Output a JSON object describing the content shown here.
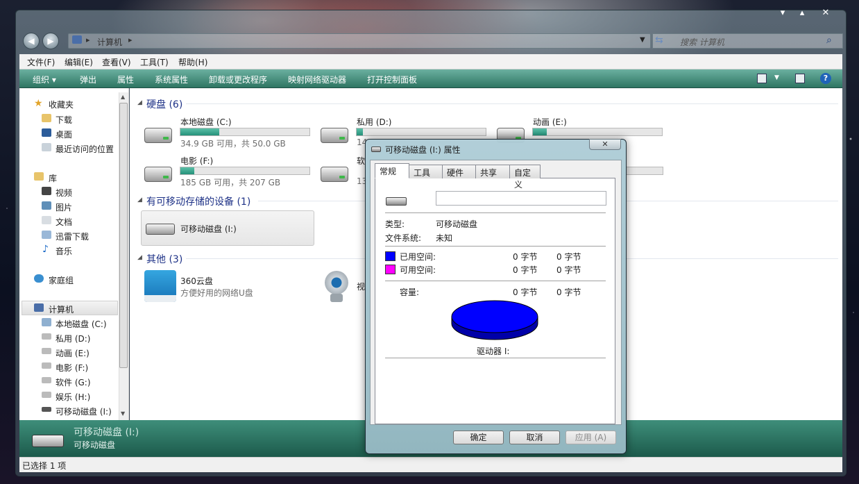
{
  "window": {
    "min": "▾",
    "max": "▴",
    "close": "✕"
  },
  "address": {
    "crumb": "计算机",
    "arrow1": "▸",
    "arrow2": "▸",
    "search_placeholder": "搜索 计算机"
  },
  "menu": [
    "文件(F)",
    "编辑(E)",
    "查看(V)",
    "工具(T)",
    "帮助(H)"
  ],
  "toolbar": [
    "组织 ▾",
    "弹出",
    "属性",
    "系统属性",
    "卸载或更改程序",
    "映射网络驱动器",
    "打开控制面板"
  ],
  "nav": {
    "favorites": "收藏夹",
    "fav_items": [
      "下载",
      "桌面",
      "最近访问的位置"
    ],
    "libraries": "库",
    "lib_items": [
      "视频",
      "图片",
      "文档",
      "迅雷下载",
      "音乐"
    ],
    "homegroup": "家庭组",
    "computer": "计算机",
    "drives": [
      "本地磁盘 (C:)",
      "私用 (D:)",
      "动画 (E:)",
      "电影 (F:)",
      "软件 (G:)",
      "娱乐 (H:)",
      "可移动磁盘 (I:)"
    ]
  },
  "groups": {
    "hdd": "硬盘 (6)",
    "removable": "有可移动存储的设备 (1)",
    "other": "其他 (3)"
  },
  "drives": [
    {
      "name": "本地磁盘 (C:)",
      "free": "34.9 GB 可用，共 50.0 GB",
      "used_fraction": 0.3
    },
    {
      "name": "私用 (D:)",
      "free": "14",
      "used_fraction": 0.05
    },
    {
      "name": "动画 (E:)",
      "free": "",
      "used_fraction": 0.11
    },
    {
      "name": "电影 (F:)",
      "free": "185 GB 可用，共 207 GB",
      "used_fraction": 0.11
    },
    {
      "name": "软",
      "free": "13",
      "used_fraction": 0.06
    }
  ],
  "removable": {
    "name": "可移动磁盘 (I:)"
  },
  "other": [
    {
      "name": "360云盘",
      "desc": "方便好用的网络U盘"
    },
    {
      "name": "视"
    }
  ],
  "details": {
    "title": "可移动磁盘 (I:)",
    "sub": "可移动磁盘"
  },
  "status": "已选择 1 项",
  "dialog": {
    "title": "可移动磁盘 (I:) 属性",
    "close": "✕",
    "tabs": [
      "常规",
      "工具",
      "硬件",
      "共享",
      "自定义"
    ],
    "type_label": "类型:",
    "type_value": "可移动磁盘",
    "fs_label": "文件系统:",
    "fs_value": "未知",
    "used_label": "已用空间:",
    "used_bytes": "0 字节",
    "used_bytes2": "0 字节",
    "free_label": "可用空间:",
    "free_bytes": "0 字节",
    "free_bytes2": "0 字节",
    "cap_label": "容量:",
    "cap_bytes": "0 字节",
    "cap_bytes2": "0 字节",
    "drive_label": "驱动器 I:",
    "ok": "确定",
    "cancel": "取消",
    "apply": "应用 (A)",
    "used_color": "#0000ff",
    "free_color": "#ff00ff"
  }
}
